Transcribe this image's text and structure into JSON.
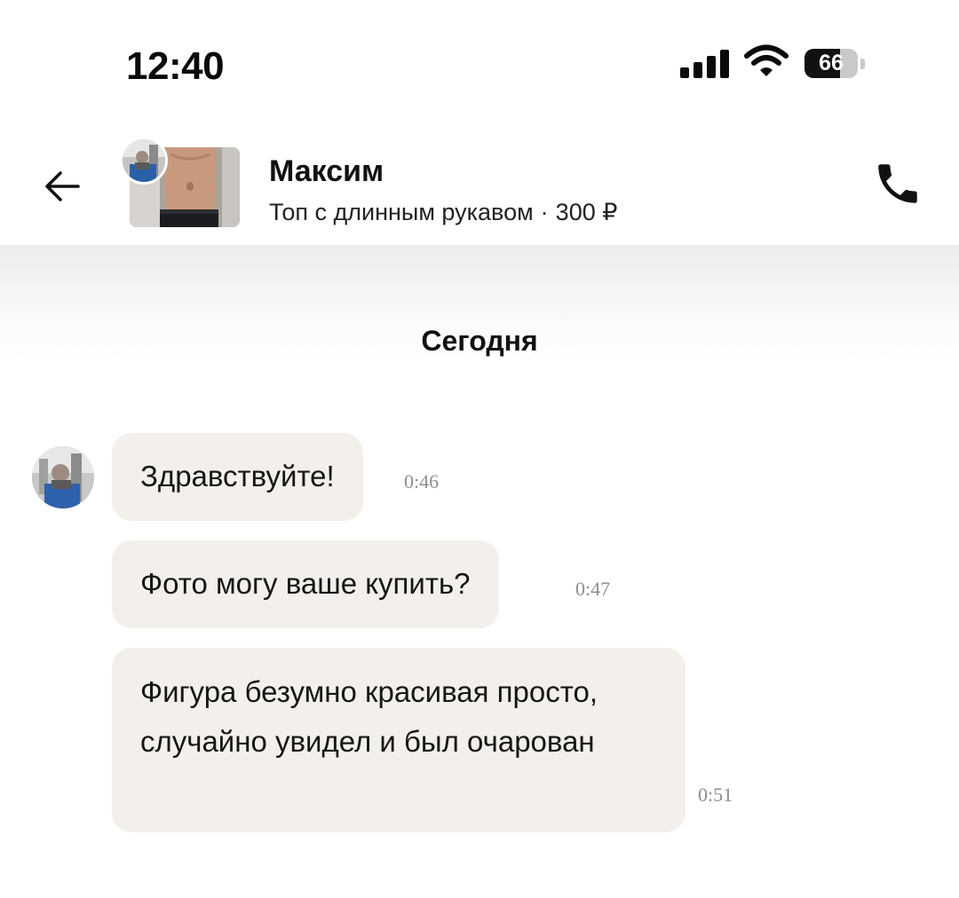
{
  "status_bar": {
    "time": "12:40",
    "battery_level": "66",
    "battery_fraction": 0.66,
    "icons": [
      "cellular-signal-icon",
      "wifi-icon",
      "battery-icon"
    ]
  },
  "header": {
    "contact_name": "Максим",
    "product_title": "Топ с длинным рукавом",
    "separator": "·",
    "product_price": "300 ₽",
    "icons": [
      "back-arrow-icon",
      "phone-icon"
    ]
  },
  "chat": {
    "date_divider": "Сегодня",
    "messages": [
      {
        "text": "Здравствуйте!",
        "time": "0:46"
      },
      {
        "text": "Фото могу ваше купить?",
        "time": "0:47"
      },
      {
        "text": "Фигура безумно красивая просто, случайно увидел и был очарован",
        "time": "0:51"
      }
    ]
  },
  "colors": {
    "bubble_bg": "#f3f0eb",
    "text": "#111111",
    "timestamp": "#8e8e8e"
  }
}
